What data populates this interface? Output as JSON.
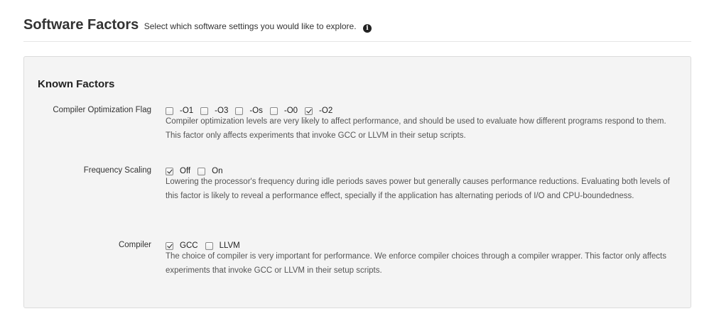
{
  "header": {
    "title": "Software Factors",
    "subtitle": "Select which software settings you would like to explore.",
    "info_icon": "info-circle-icon"
  },
  "panel": {
    "title": "Known Factors",
    "factors": [
      {
        "label": "Compiler Optimization Flag",
        "options": [
          {
            "label": "-O1",
            "checked": false
          },
          {
            "label": "-O3",
            "checked": false
          },
          {
            "label": "-Os",
            "checked": false
          },
          {
            "label": "-O0",
            "checked": false
          },
          {
            "label": "-O2",
            "checked": true
          }
        ],
        "description": "Compiler optimization levels are very likely to affect performance, and should be used to evaluate how different programs respond to them. This factor only affects experiments that invoke GCC or LLVM in their setup scripts."
      },
      {
        "label": "Frequency Scaling",
        "options": [
          {
            "label": "Off",
            "checked": true
          },
          {
            "label": "On",
            "checked": false
          }
        ],
        "description": "Lowering the processor's frequency during idle periods saves power but generally causes performance reductions. Evaluating both levels of this factor is likely to reveal a performance effect, specially if the application has alternating periods of I/O and CPU-boundedness."
      },
      {
        "label": "Compiler",
        "options": [
          {
            "label": "GCC",
            "checked": true
          },
          {
            "label": "LLVM",
            "checked": false
          }
        ],
        "description": "The choice of compiler is very important for performance. We enforce compiler choices through a compiler wrapper. This factor only affects experiments that invoke GCC or LLVM in their setup scripts."
      }
    ]
  }
}
